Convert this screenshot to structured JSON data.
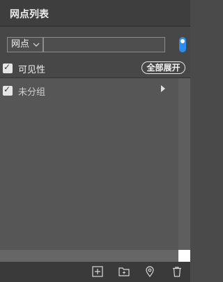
{
  "panel": {
    "title": "网点列表"
  },
  "search": {
    "type_value": "网点",
    "input_value": "",
    "input_placeholder": "",
    "toggle_on": true
  },
  "visibility": {
    "label": "可见性",
    "checked": true,
    "expand_all_label": "全部展开"
  },
  "groups": [
    {
      "label": "未分组",
      "checked": true,
      "expanded": false
    }
  ],
  "toolbar": {
    "icons": [
      "add-icon",
      "add-folder-icon",
      "location-icon",
      "trash-icon"
    ]
  },
  "colors": {
    "toggle": "#2d8cf0",
    "background": "#4c4c4c"
  }
}
